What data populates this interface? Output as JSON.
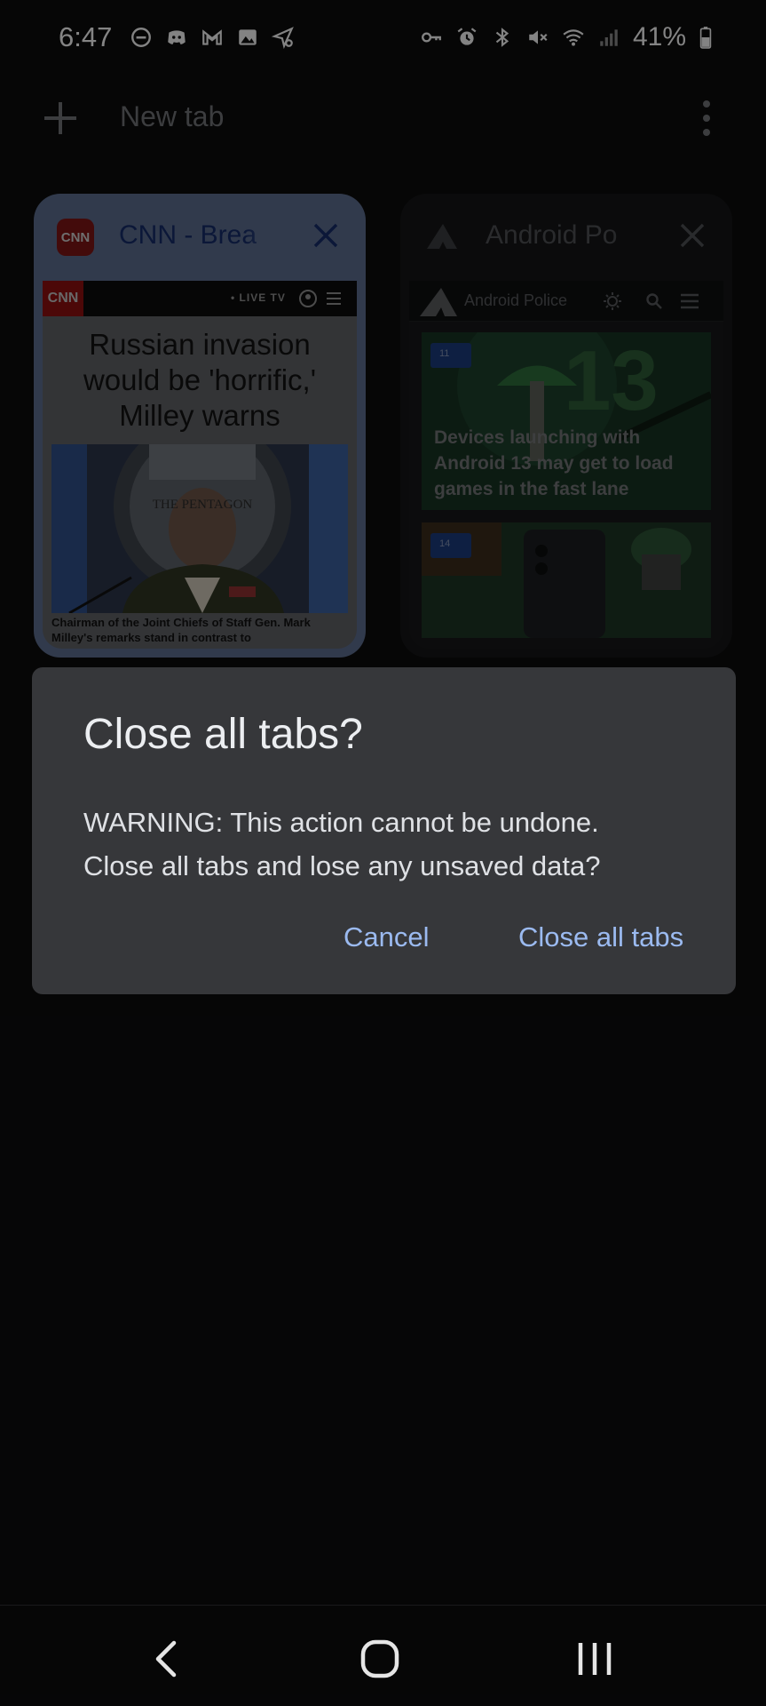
{
  "status_bar": {
    "time": "6:47",
    "battery": "41%"
  },
  "toolbar": {
    "new_tab_label": "New tab"
  },
  "tabs": [
    {
      "title": "CNN - Brea",
      "favicon_text": "CNN",
      "thumbnail": {
        "logo": "CNN",
        "live_label": "• LIVE TV",
        "headline": "Russian invasion would be 'horrific,' Milley warns",
        "photo_sign": "THE PENTAGON",
        "caption": "Chairman of the Joint Chiefs of Staff Gen. Mark Milley's remarks stand in contrast to"
      }
    },
    {
      "title": "Android Po",
      "thumbnail": {
        "brand": "Android Police",
        "card1_badge": "11",
        "card1_big": "13",
        "card1_caption": "Devices launching with Android 13 may get to load games in the fast lane",
        "card2_badge": "14"
      }
    }
  ],
  "dialog": {
    "title": "Close all tabs?",
    "body_line1": "WARNING: This action cannot be undone.",
    "body_line2": "Close all tabs and lose any unsaved data?",
    "cancel_label": "Cancel",
    "confirm_label": "Close all tabs"
  },
  "colors": {
    "accent": "#9bbaf0",
    "dialog_bg": "#36373a",
    "page_bg": "#0b0b0c"
  }
}
